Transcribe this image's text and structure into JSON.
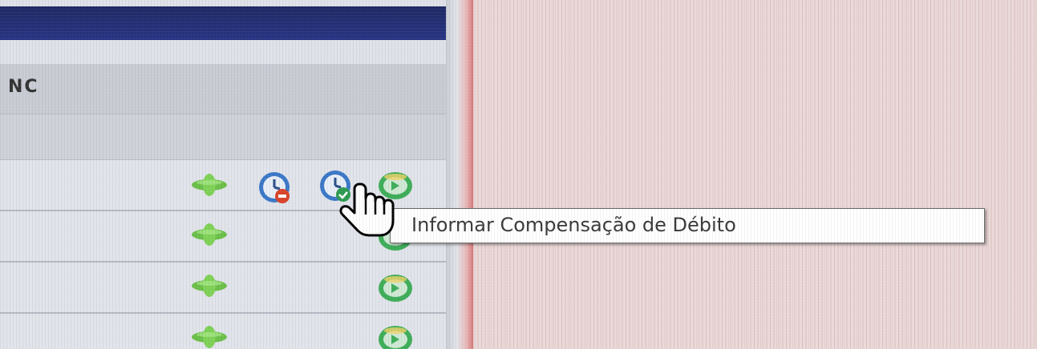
{
  "grid": {
    "header_label": "NC",
    "rows": [
      {
        "icons": [
          "plus-icon",
          "clock-red-icon",
          "clock-green-icon",
          "disc-icon"
        ]
      },
      {
        "icons": [
          "plus-icon",
          "disc-icon"
        ]
      },
      {
        "icons": [
          "plus-icon",
          "disc-icon"
        ]
      },
      {
        "icons": [
          "plus-icon",
          "disc-icon"
        ]
      }
    ]
  },
  "tooltip": {
    "text": "Informar Compensação de Débito"
  },
  "colors": {
    "titlebar": "#1f2a66",
    "plus": "#6cc04a",
    "disc": "#3fae5a",
    "clock_blue": "#3b78c8",
    "clock_badge_red": "#d9442a",
    "clock_badge_green": "#2e9b52",
    "divider_red": "#d67a7a"
  }
}
